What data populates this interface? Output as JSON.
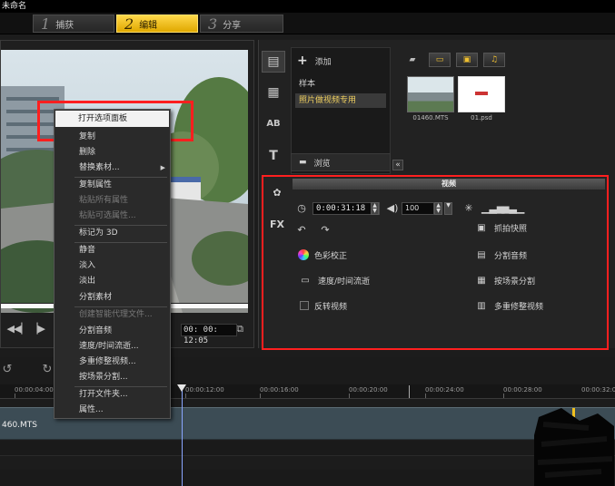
{
  "window": {
    "title": "未命名"
  },
  "steps": [
    {
      "num": "1",
      "label": "捕获",
      "active": false
    },
    {
      "num": "2",
      "label": "编辑",
      "active": true
    },
    {
      "num": "3",
      "label": "分享",
      "active": false
    }
  ],
  "preview": {
    "timecode": "00: 00: 12:05",
    "playback_progress": 1.0,
    "control_icons": [
      "prev-icon",
      "step-back-icon",
      "step-forward-icon",
      "mark-in-icon",
      "mark-out-icon",
      "cut-icon",
      "enlarge-icon"
    ]
  },
  "library": {
    "add_label": "添加",
    "nav_items": [
      {
        "label": "样本",
        "selected": false
      },
      {
        "label": "照片做视频专用",
        "selected": true
      }
    ],
    "browse_label": "浏览",
    "thumbnails": [
      {
        "label": "01460.MTS"
      },
      {
        "label": "01.psd"
      }
    ]
  },
  "options": {
    "header": "视频",
    "timecode": "0:00:31:18",
    "volume": "100",
    "left_items": [
      "色彩校正",
      "速度/时间流逝",
      "反转视频"
    ],
    "right_items": [
      "抓拍快照",
      "分割音频",
      "按场景分割",
      "多重修整视频"
    ]
  },
  "context_menu": {
    "items": [
      {
        "label": "打开选项面板",
        "disabled": false,
        "highlight": true
      },
      {
        "label": "复制",
        "disabled": false
      },
      {
        "label": "删除",
        "disabled": false
      },
      {
        "label": "替换素材...",
        "disabled": false,
        "submenu": true
      },
      {
        "label": "复制属性",
        "disabled": false
      },
      {
        "label": "粘贴所有属性",
        "disabled": true
      },
      {
        "label": "粘贴可选属性...",
        "disabled": true
      },
      {
        "label": "标记为 3D",
        "disabled": false
      },
      {
        "label": "静音",
        "disabled": false
      },
      {
        "label": "淡入",
        "disabled": false
      },
      {
        "label": "淡出",
        "disabled": false
      },
      {
        "label": "分割素材",
        "disabled": false
      },
      {
        "label": "创建智能代理文件...",
        "disabled": true
      },
      {
        "label": "分割音频",
        "disabled": false
      },
      {
        "label": "速度/时间流逝...",
        "disabled": false
      },
      {
        "label": "多重修整视频...",
        "disabled": false
      },
      {
        "label": "按场景分割...",
        "disabled": false
      },
      {
        "label": "打开文件夹...",
        "disabled": false
      },
      {
        "label": "属性...",
        "disabled": false
      }
    ]
  },
  "timeline": {
    "ruler_labels": [
      "00:00:04:00",
      "00:00:12:00",
      "00:00:16:00",
      "00:00:20:00",
      "00:00:24:00",
      "00:00:28:00",
      "00:00:32:00"
    ],
    "clip_label": "460.MTS"
  },
  "colors": {
    "accent": "#f0c020",
    "highlight_red": "#ff1f1f"
  }
}
